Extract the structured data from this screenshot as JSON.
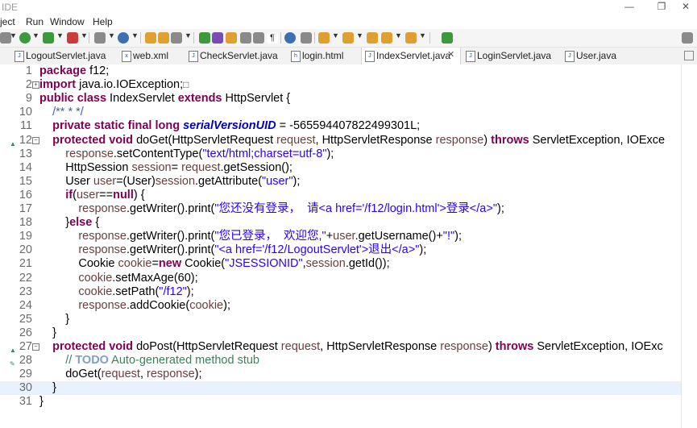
{
  "window": {
    "title": "IDE",
    "controls": [
      "—",
      "❐",
      "✕"
    ]
  },
  "menu": [
    "ject",
    "Run",
    "Window",
    "Help"
  ],
  "tabs": [
    {
      "label": "LogoutServlet.java",
      "icon": "java-file-icon",
      "active": false
    },
    {
      "label": "web.xml",
      "icon": "xml-file-icon",
      "active": false
    },
    {
      "label": "CheckServlet.java",
      "icon": "java-file-icon",
      "active": false
    },
    {
      "label": "login.html",
      "icon": "html-file-icon",
      "active": false
    },
    {
      "label": "IndexServlet.java",
      "icon": "java-file-icon",
      "active": true,
      "close": "✕"
    },
    {
      "label": "LoginServlet.java",
      "icon": "java-file-icon",
      "active": false
    },
    {
      "label": "User.java",
      "icon": "java-file-icon",
      "active": false
    }
  ],
  "toolbar": {
    "search_icon": "magnifier-icon",
    "colors": {
      "green": "#3c9a3c",
      "red": "#c83c3c",
      "blue": "#3d6fb5",
      "orange": "#e0a030",
      "purple": "#7a4db3",
      "gray": "#8a8a8a"
    }
  },
  "code_lines": [
    {
      "ln": "1",
      "tokens": [
        [
          "kw",
          "package "
        ],
        [
          "",
          "f12;"
        ]
      ]
    },
    {
      "ln": "2",
      "fold": "+",
      "tokens": [
        [
          "kw",
          "import "
        ],
        [
          "",
          "java.io.IOException;"
        ],
        [
          "box",
          "□"
        ]
      ]
    },
    {
      "ln": "9",
      "tokens": [
        [
          "kw",
          "public class "
        ],
        [
          "",
          "IndexServlet "
        ],
        [
          "kw",
          "extends "
        ],
        [
          "",
          "HttpServlet {"
        ]
      ]
    },
    {
      "ln": "10",
      "tokens": [
        [
          "",
          "    "
        ],
        [
          "jd",
          "/** * */"
        ]
      ]
    },
    {
      "ln": "11",
      "tokens": [
        [
          "",
          "    "
        ],
        [
          "kw",
          "private static final long "
        ],
        [
          "fld",
          "serialVersionUID"
        ],
        [
          "",
          " = -565594407822499301L;"
        ]
      ]
    },
    {
      "ln": "12",
      "marker": "▲",
      "fold": "−",
      "tokens": [
        [
          "",
          "    "
        ],
        [
          "kw",
          "protected void "
        ],
        [
          "",
          "doGet(HttpServletRequest "
        ],
        [
          "var",
          "request"
        ],
        [
          "",
          ", HttpServletResponse "
        ],
        [
          "var",
          "response"
        ],
        [
          "",
          ") "
        ],
        [
          "kw",
          "throws "
        ],
        [
          "",
          "ServletException, IOExce"
        ]
      ]
    },
    {
      "ln": "13",
      "tokens": [
        [
          "",
          "        "
        ],
        [
          "var",
          "response"
        ],
        [
          "",
          ".setContentType("
        ],
        [
          "str",
          "\"text/html;charset=utf-8\""
        ],
        [
          "",
          ");"
        ]
      ]
    },
    {
      "ln": "14",
      "tokens": [
        [
          "",
          "        HttpSession "
        ],
        [
          "var",
          "session"
        ],
        [
          "",
          "= "
        ],
        [
          "var",
          "request"
        ],
        [
          "",
          ".getSession();"
        ]
      ]
    },
    {
      "ln": "15",
      "tokens": [
        [
          "",
          "        User "
        ],
        [
          "var",
          "user"
        ],
        [
          "",
          "=(User)"
        ],
        [
          "var",
          "session"
        ],
        [
          "",
          ".getAttribute("
        ],
        [
          "str",
          "\"user\""
        ],
        [
          "",
          ");"
        ]
      ]
    },
    {
      "ln": "16",
      "tokens": [
        [
          "",
          "        "
        ],
        [
          "kw",
          "if"
        ],
        [
          "",
          "("
        ],
        [
          "var",
          "user"
        ],
        [
          "",
          "=="
        ],
        [
          "kw",
          "null"
        ],
        [
          "",
          ") {"
        ]
      ]
    },
    {
      "ln": "17",
      "tokens": [
        [
          "",
          "            "
        ],
        [
          "var",
          "response"
        ],
        [
          "",
          ".getWriter().print("
        ],
        [
          "str",
          "\"您还没有登录，  请<a href='/f12/login.html'>登录</a>\""
        ],
        [
          "",
          ");"
        ]
      ]
    },
    {
      "ln": "18",
      "tokens": [
        [
          "",
          "        }"
        ],
        [
          "kw",
          "else "
        ],
        [
          "",
          "{"
        ]
      ]
    },
    {
      "ln": "19",
      "tokens": [
        [
          "",
          "            "
        ],
        [
          "var",
          "response"
        ],
        [
          "",
          ".getWriter().print("
        ],
        [
          "str",
          "\"您已登录，  欢迎您,\""
        ],
        [
          "",
          "+"
        ],
        [
          "var",
          "user"
        ],
        [
          "",
          ".getUsername()+"
        ],
        [
          "str",
          "\"!\""
        ],
        [
          "",
          ");"
        ]
      ]
    },
    {
      "ln": "20",
      "tokens": [
        [
          "",
          "            "
        ],
        [
          "var",
          "response"
        ],
        [
          "",
          ".getWriter().print("
        ],
        [
          "str",
          "\"<a href='/f12/LogoutServlet'>退出</a>\""
        ],
        [
          "",
          ");"
        ]
      ]
    },
    {
      "ln": "21",
      "tokens": [
        [
          "",
          "            Cookie "
        ],
        [
          "var",
          "cookie"
        ],
        [
          "",
          "="
        ],
        [
          "kw",
          "new "
        ],
        [
          "",
          "Cookie("
        ],
        [
          "str",
          "\"JSESSIONID\""
        ],
        [
          "",
          ","
        ],
        [
          "var",
          "session"
        ],
        [
          "",
          ".getId());"
        ]
      ]
    },
    {
      "ln": "22",
      "tokens": [
        [
          "",
          "            "
        ],
        [
          "var",
          "cookie"
        ],
        [
          "",
          ".setMaxAge(60);"
        ]
      ]
    },
    {
      "ln": "23",
      "tokens": [
        [
          "",
          "            "
        ],
        [
          "var",
          "cookie"
        ],
        [
          "",
          ".setPath("
        ],
        [
          "str",
          "\"/f12\""
        ],
        [
          "",
          ");"
        ]
      ]
    },
    {
      "ln": "24",
      "tokens": [
        [
          "",
          "            "
        ],
        [
          "var",
          "response"
        ],
        [
          "",
          ".addCookie("
        ],
        [
          "var",
          "cookie"
        ],
        [
          "",
          ");"
        ]
      ]
    },
    {
      "ln": "25",
      "tokens": [
        [
          "",
          "        }"
        ]
      ]
    },
    {
      "ln": "26",
      "tokens": [
        [
          "",
          "    }"
        ]
      ]
    },
    {
      "ln": "27",
      "marker": "▲",
      "fold": "−",
      "tokens": [
        [
          "",
          "    "
        ],
        [
          "kw",
          "protected void "
        ],
        [
          "",
          "doPost(HttpServletRequest "
        ],
        [
          "var",
          "request"
        ],
        [
          "",
          ", HttpServletResponse "
        ],
        [
          "var",
          "response"
        ],
        [
          "",
          ") "
        ],
        [
          "kw",
          "throws "
        ],
        [
          "",
          "ServletException, IOExc"
        ]
      ]
    },
    {
      "ln": "28",
      "marker": "✎",
      "tokens": [
        [
          "",
          "        "
        ],
        [
          "cm",
          "// "
        ],
        [
          "todo",
          "TODO"
        ],
        [
          "cm",
          " Auto-generated method stub"
        ]
      ]
    },
    {
      "ln": "29",
      "tokens": [
        [
          "",
          "        doGet("
        ],
        [
          "var",
          "request"
        ],
        [
          "",
          ", "
        ],
        [
          "var",
          "response"
        ],
        [
          "",
          ");"
        ]
      ]
    },
    {
      "ln": "30",
      "highlight": true,
      "tokens": [
        [
          "",
          "    }"
        ]
      ]
    },
    {
      "ln": "31",
      "tokens": [
        [
          "",
          "}"
        ]
      ]
    }
  ]
}
